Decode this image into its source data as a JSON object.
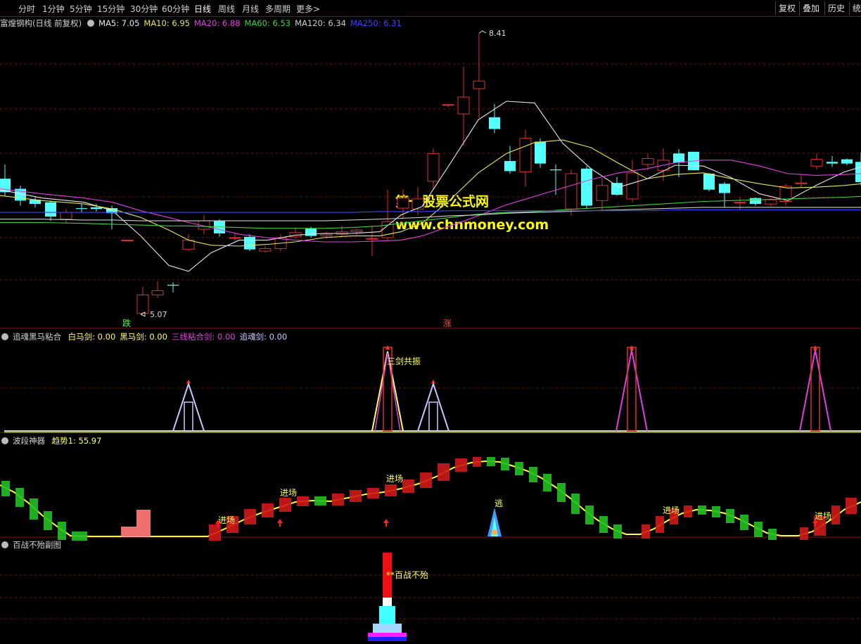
{
  "toolbar": {
    "periods": [
      "分时",
      "1分钟",
      "5分钟",
      "15分钟",
      "30分钟",
      "60分钟",
      "日线",
      "周线",
      "月线",
      "多周期",
      "更多"
    ],
    "active": "日线",
    "more_arrow": ">",
    "right_buttons": [
      "复权",
      "叠加",
      "历史",
      "统"
    ]
  },
  "colors": {
    "up": "#e03030",
    "down": "#54ffff",
    "ma5": "#e8e8e8",
    "ma10": "#e6e65a",
    "ma20": "#e040e0",
    "ma60": "#40d040",
    "ma120": "#cfcfcf",
    "ma250": "#4040ff",
    "grid": "#7a1010",
    "accent": "#ffff00"
  },
  "price_panel": {
    "title": "富煌钢构(日线 前复权)",
    "ma_labels": [
      {
        "name": "MA5",
        "value": "MA5: 7.05",
        "color": "#e8e8e8"
      },
      {
        "name": "MA10",
        "value": "MA10: 6.95",
        "color": "#e6e65a"
      },
      {
        "name": "MA20",
        "value": "MA20: 6.88",
        "color": "#e040e0"
      },
      {
        "name": "MA60",
        "value": "MA60: 6.53",
        "color": "#40d040"
      },
      {
        "name": "MA120",
        "value": "MA120: 6.34",
        "color": "#cfcfcf"
      },
      {
        "name": "MA250",
        "value": "MA250: 6.31",
        "color": "#4040ff"
      }
    ],
    "high_label": "8.41",
    "low_label": "5.07",
    "high_value": 8.41,
    "low_value": 5.07,
    "low_marker": "跌",
    "high_marker": "涨",
    "watermark_cn": "第一股票公式网",
    "watermark_url": "www.chnmoney.com"
  },
  "panel2": {
    "title": "追魂黑马粘合",
    "values": [
      {
        "label": "白马剑: 0.00",
        "color": "#ffff60"
      },
      {
        "label": "黑马剑: 0.00",
        "color": "#ffff60"
      },
      {
        "label": "三线粘合剑: 0.00",
        "color": "#e040e0"
      },
      {
        "label": "追魂剑: 0.00",
        "color": "#c8c8ff"
      }
    ],
    "annotation": "三剑共振"
  },
  "panel3": {
    "title": "波段神器",
    "values": [
      {
        "label": "趋势1: 55.97",
        "color": "#ffff60"
      }
    ],
    "entry_label": "进场",
    "escape_label": "逃"
  },
  "panel4": {
    "title": "百战不殆副图",
    "annotation": "**百战不殆"
  }
}
